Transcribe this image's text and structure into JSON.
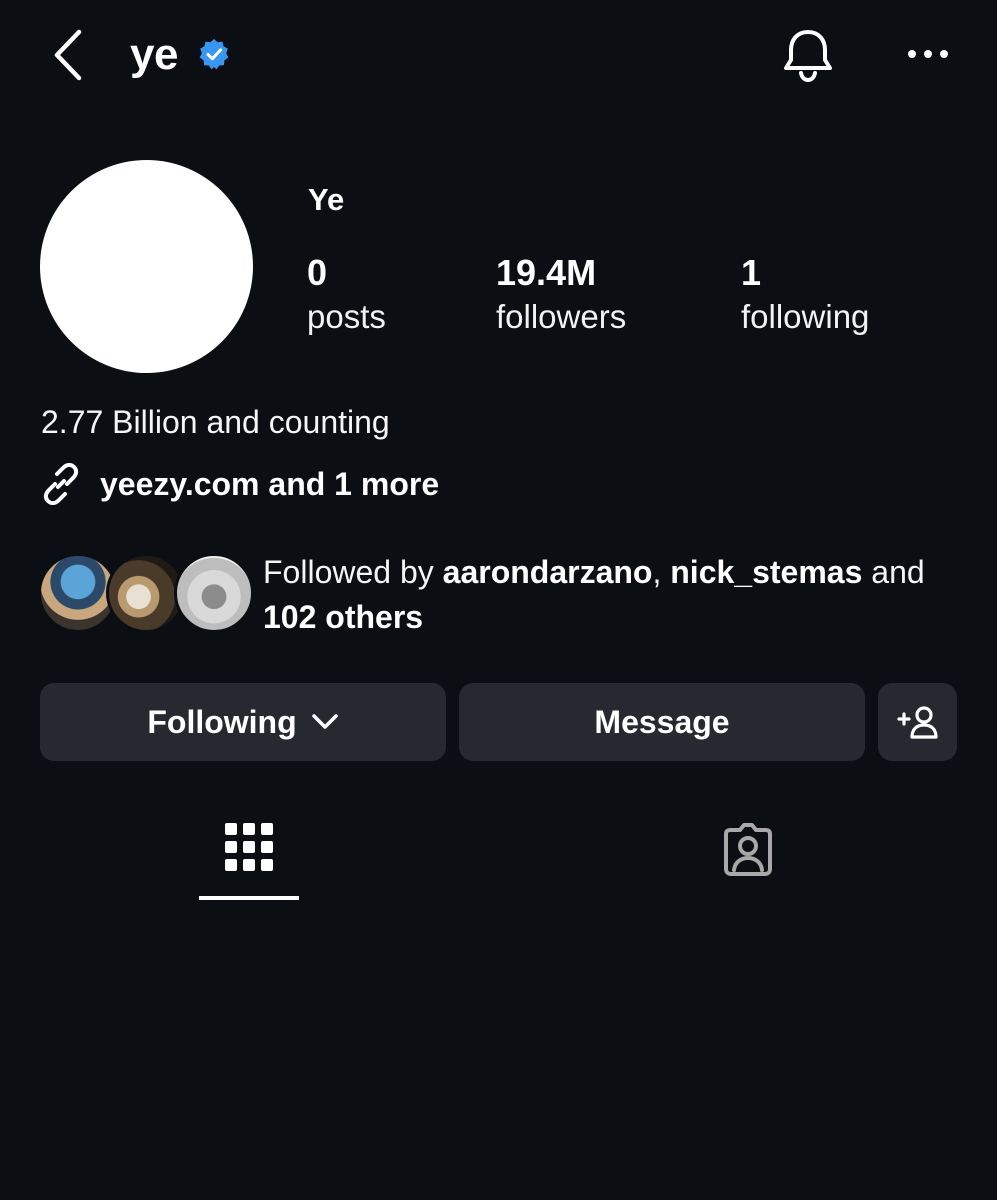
{
  "header": {
    "username": "ye",
    "icons": [
      "back-chevron-icon",
      "verified-badge-icon",
      "bell-icon",
      "more-options-icon"
    ],
    "verified_color": "#3897f0"
  },
  "profile": {
    "display_name": "Ye",
    "stats": [
      {
        "value": "0",
        "label": "posts"
      },
      {
        "value": "19.4M",
        "label": "followers"
      },
      {
        "value": "1",
        "label": "following"
      }
    ],
    "bio": "2.77 Billion and counting",
    "link_text": "yeezy.com and 1 more",
    "link_icon": "link-icon"
  },
  "followed_by": {
    "prefix": "Followed by ",
    "user1": "aarondarzano",
    "separator": ", ",
    "user2": "nick_stemas",
    "middle": " and ",
    "others": "102 others"
  },
  "actions": {
    "following_label": "Following",
    "following_icon": "chevron-down-icon",
    "message_label": "Message",
    "add_icon": "add-person-icon"
  },
  "tabs": [
    {
      "name": "posts-grid",
      "icon": "grid-icon",
      "active": true
    },
    {
      "name": "tagged",
      "icon": "tagged-person-icon",
      "active": false
    }
  ],
  "colors": {
    "background": "#0b0f14",
    "button": "#262a30",
    "text": "#ffffff"
  }
}
